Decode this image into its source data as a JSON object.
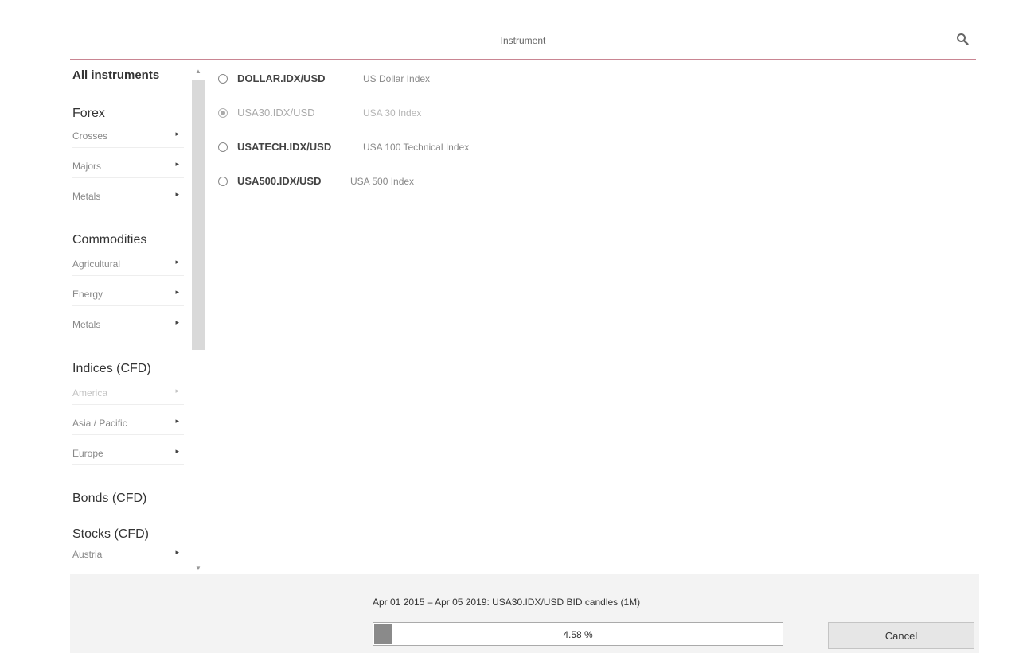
{
  "header": {
    "title": "Instrument",
    "search_icon": "search-icon"
  },
  "sidebar": {
    "all_label": "All instruments",
    "groups": [
      {
        "label": "Forex",
        "items": [
          {
            "label": "Crosses",
            "disabled": false
          },
          {
            "label": "Majors",
            "disabled": false
          },
          {
            "label": "Metals",
            "disabled": false
          }
        ]
      },
      {
        "label": "Commodities",
        "items": [
          {
            "label": "Agricultural",
            "disabled": false
          },
          {
            "label": "Energy",
            "disabled": false
          },
          {
            "label": "Metals",
            "disabled": false
          }
        ]
      },
      {
        "label": "Indices (CFD)",
        "items": [
          {
            "label": "America",
            "disabled": true
          },
          {
            "label": "Asia / Pacific",
            "disabled": false
          },
          {
            "label": "Europe",
            "disabled": false
          }
        ]
      },
      {
        "label": "Bonds (CFD)",
        "items": []
      },
      {
        "label": "Stocks (CFD)",
        "items": [
          {
            "label": "Austria",
            "disabled": false
          }
        ]
      }
    ],
    "arrow_glyph": "▸",
    "scroll_up_glyph": "▲",
    "scroll_down_glyph": "▼"
  },
  "instruments": [
    {
      "code": "DOLLAR.IDX/USD",
      "desc": "US Dollar Index",
      "selected": false
    },
    {
      "code": "USA30.IDX/USD",
      "desc": "USA 30 Index",
      "selected": true
    },
    {
      "code": "USATECH.IDX/USD",
      "desc": "USA 100 Technical Index",
      "selected": false
    },
    {
      "code": "USA500.IDX/USD",
      "desc": "USA 500 Index",
      "selected": false
    }
  ],
  "footer": {
    "status": "Apr 01 2015 – Apr 05 2019: USA30.IDX/USD BID candles (1M)",
    "progress_percent": 4.58,
    "progress_label": "4.58 %",
    "cancel_label": "Cancel"
  },
  "colors": {
    "header_rule": "#c98592",
    "progress_fill": "#8a8a8a",
    "footer_bg": "#f3f3f3"
  }
}
